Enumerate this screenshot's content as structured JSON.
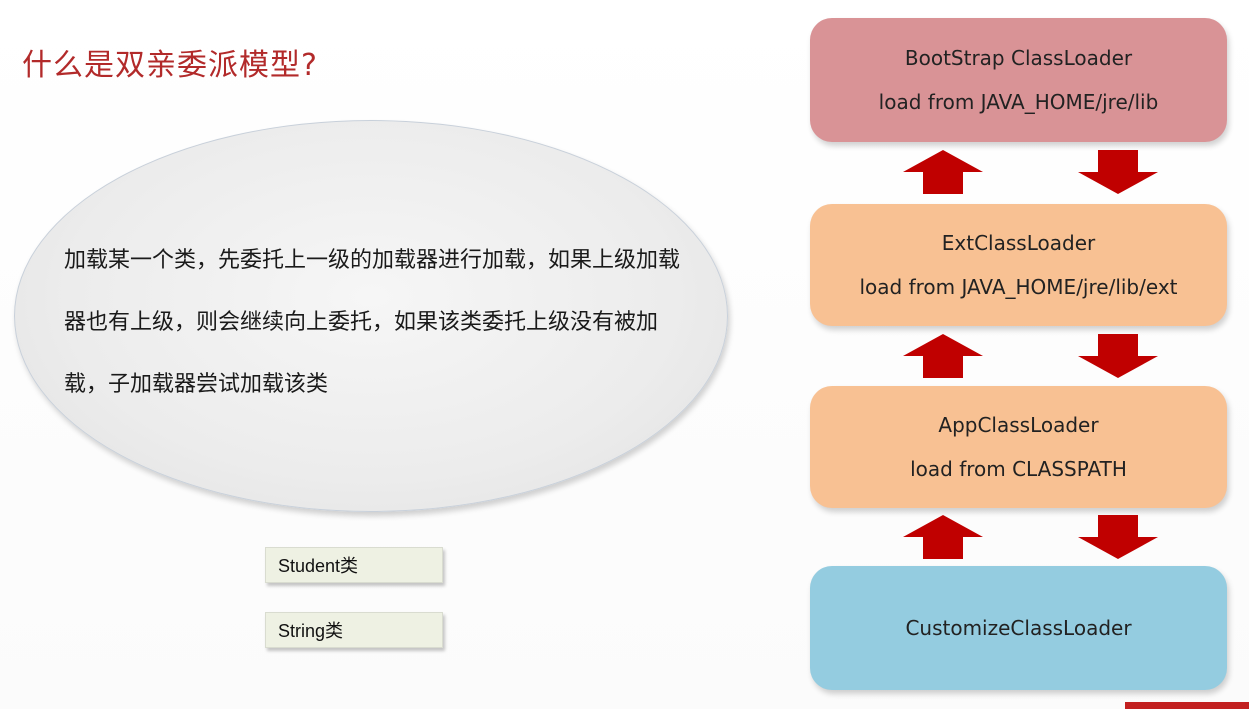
{
  "slide": {
    "title": "什么是双亲委派模型?",
    "description": "加载某一个类，先委托上一级的加载器进行加载，如果上级加载器也有上级，则会继续向上委托，如果该类委托上级没有被加载，子加载器尝试加载该类",
    "tags": {
      "student": "Student类",
      "string": "String类"
    }
  },
  "loaders": {
    "bootstrap": {
      "name": "BootStrap ClassLoader",
      "path": "load from JAVA_HOME/jre/lib",
      "color": "#d99396"
    },
    "ext": {
      "name": "ExtClassLoader",
      "path": "load from JAVA_HOME/jre/lib/ext",
      "color": "#f8c193"
    },
    "app": {
      "name": "AppClassLoader",
      "path": "load from CLASSPATH",
      "color": "#f8c193"
    },
    "custom": {
      "name": "CustomizeClassLoader",
      "color": "#94cce0"
    }
  },
  "colors": {
    "title": "#b22a2a",
    "arrow": "#c00000"
  }
}
